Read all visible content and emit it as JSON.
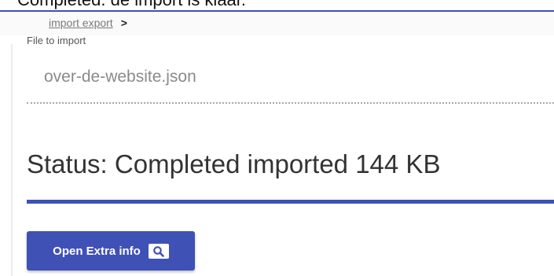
{
  "notice": {
    "text": "Completed. de import is klaar."
  },
  "breadcrumb": {
    "link": "import export",
    "separator": ">"
  },
  "file_field": {
    "label": "File to import",
    "value": "over-de-website.json"
  },
  "status": {
    "text": "Status: Completed imported 144 KB"
  },
  "progress": {
    "fraction": 1.0
  },
  "actions": {
    "extra_info_label": "Open Extra info",
    "extra_info_icon": "search-icon"
  },
  "colors": {
    "accent": "#3f51b5"
  }
}
